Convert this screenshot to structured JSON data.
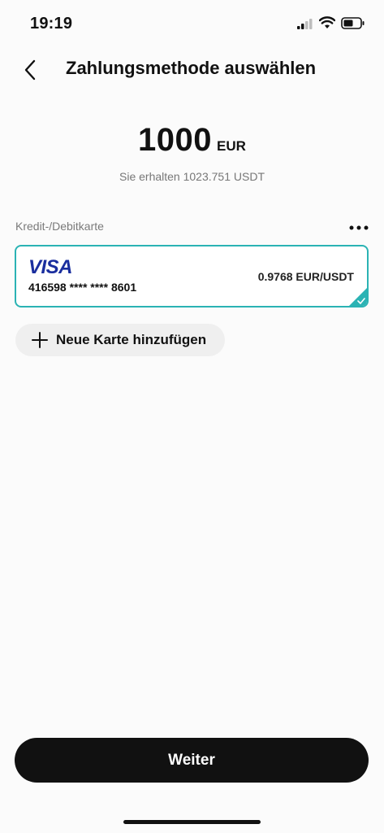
{
  "status": {
    "time": "19:19"
  },
  "header": {
    "title": "Zahlungsmethode auswählen",
    "back_icon": "chevron-left-icon"
  },
  "amount": {
    "value": "1000",
    "currency": "EUR",
    "receive_text": "Sie erhalten 1023.751 USDT"
  },
  "payment": {
    "section_label": "Kredit-/Debitkarte",
    "more_icon": "more-horizontal-icon",
    "card": {
      "brand": "VISA",
      "number": "416598 **** **** 8601",
      "rate": "0.9768 EUR/USDT",
      "selected": true
    },
    "add_card_label": "Neue Karte hinzufügen"
  },
  "footer": {
    "continue_label": "Weiter"
  },
  "colors": {
    "accent": "#2bb3b4",
    "visa_blue": "#1a2e9e",
    "button_bg": "#111111"
  }
}
